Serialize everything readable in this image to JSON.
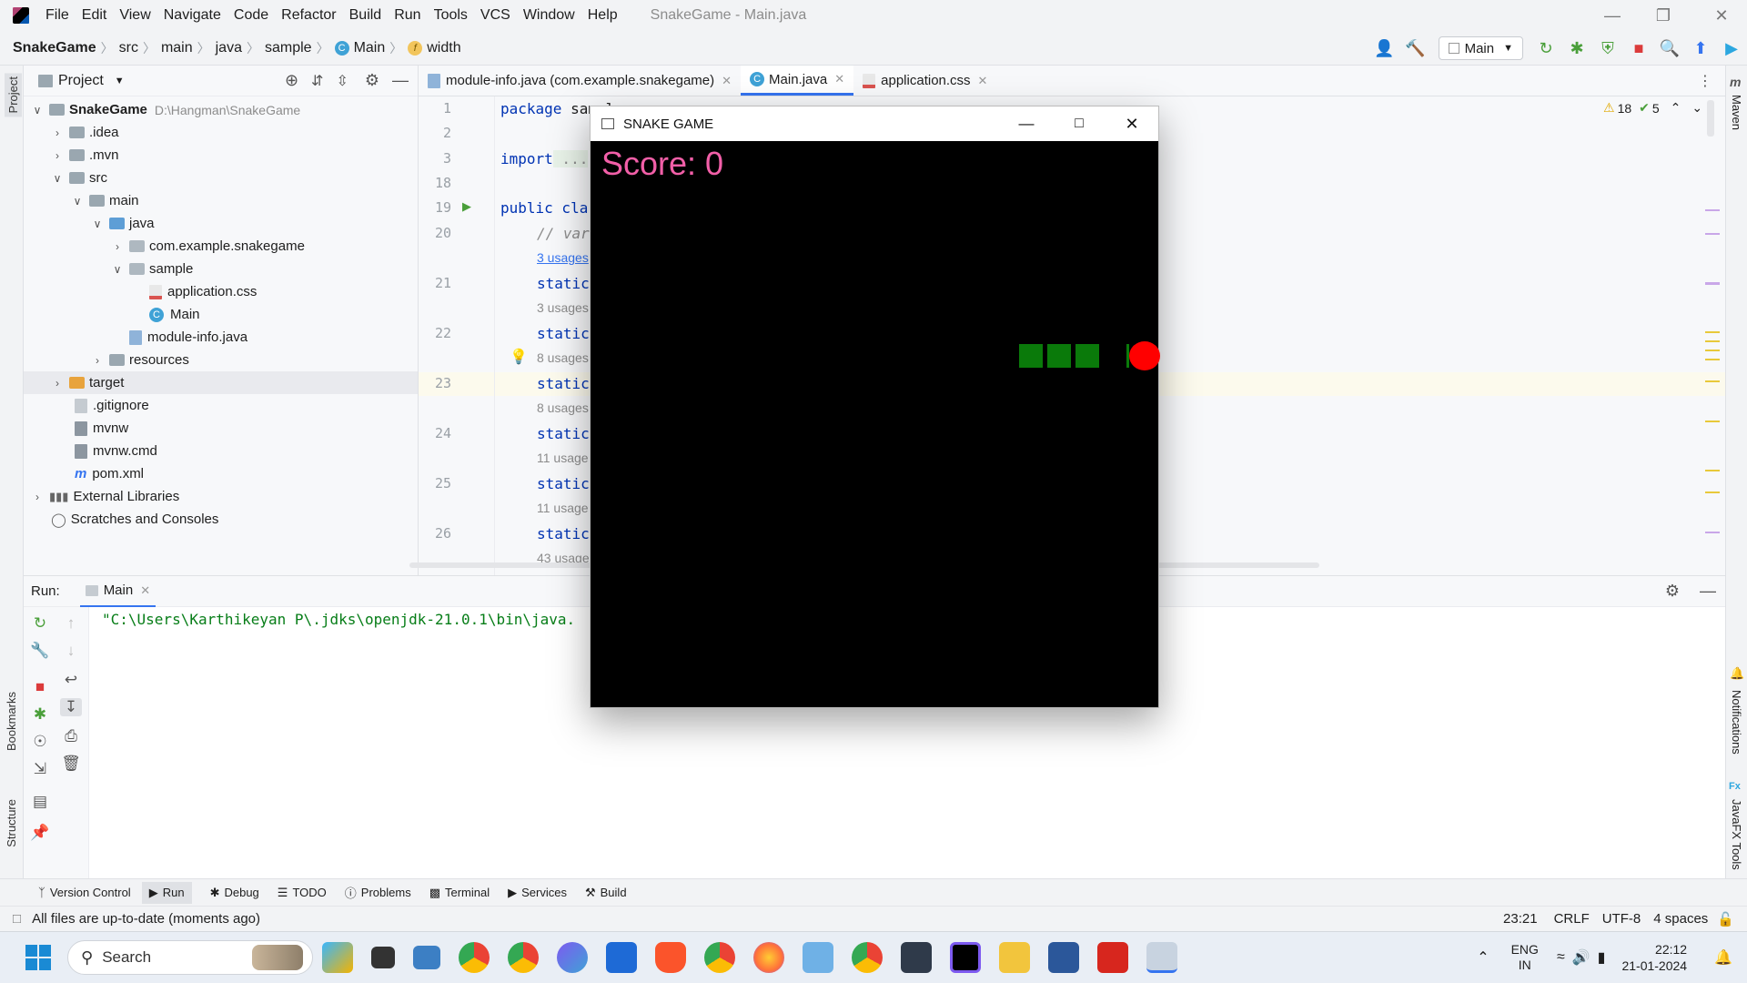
{
  "menubar": {
    "items": [
      "File",
      "Edit",
      "View",
      "Navigate",
      "Code",
      "Refactor",
      "Build",
      "Run",
      "Tools",
      "VCS",
      "Window",
      "Help"
    ],
    "window_title": "SnakeGame - Main.java"
  },
  "navbar": {
    "crumbs": [
      "SnakeGame",
      "src",
      "main",
      "java",
      "sample",
      "Main",
      "width"
    ],
    "run_config": "Main"
  },
  "project": {
    "header": "Project",
    "root_name": "SnakeGame",
    "root_path": "D:\\Hangman\\SnakeGame",
    "items": {
      "idea": ".idea",
      "mvn": ".mvn",
      "src": "src",
      "main": "main",
      "java": "java",
      "pkg1": "com.example.snakegame",
      "sample": "sample",
      "css": "application.css",
      "main_class": "Main",
      "module_info": "module-info.java",
      "resources": "resources",
      "target": "target",
      "gitignore": ".gitignore",
      "mvnw": "mvnw",
      "mvnw_cmd": "mvnw.cmd",
      "pom": "pom.xml",
      "ext_libs": "External Libraries",
      "scratches": "Scratches and Consoles"
    }
  },
  "tabs": [
    "module-info.java (com.example.snakegame)",
    "Main.java",
    "application.css"
  ],
  "editor": {
    "line_numbers": [
      "1",
      "2",
      "3",
      "18",
      "19",
      "20",
      "21",
      "22",
      "23",
      "24",
      "25",
      "26"
    ],
    "code": {
      "l1_kw": "package",
      "l1_rest": " sample;",
      "l3_kw": "import",
      "l3_rest": " ...",
      "l19_kw": "public",
      "l19_rest": " cla",
      "l20": "// var",
      "static": "static"
    },
    "hints": [
      "3 usages",
      "3 usages",
      "8 usages",
      "8 usages",
      "11 usage",
      "11 usage",
      "43 usage"
    ],
    "warnings": "18",
    "checks": "5"
  },
  "run": {
    "label": "Run:",
    "tab": "Main",
    "console": "\"C:\\Users\\Karthikeyan P\\.jdks\\openjdk-21.0.1\\bin\\java."
  },
  "side_labels": {
    "left_top": "Project",
    "bookmarks": "Bookmarks",
    "structure": "Structure",
    "maven": "Maven",
    "notifications": "Notifications",
    "javafx": "JavaFX Tools"
  },
  "tool_tabs": [
    "Version Control",
    "Run",
    "Debug",
    "TODO",
    "Problems",
    "Terminal",
    "Services",
    "Build"
  ],
  "status": {
    "message": "All files are up-to-date (moments ago)",
    "position": "23:21",
    "line_sep": "CRLF",
    "encoding": "UTF-8",
    "indent": "4 spaces"
  },
  "taskbar": {
    "search": "Search",
    "lang1": "ENG",
    "lang2": "IN",
    "time": "22:12",
    "date": "21-01-2024"
  },
  "snake_game": {
    "title": "SNAKE GAME",
    "score_text": "Score: 0",
    "colors": {
      "snake": "#0a7a0a",
      "food": "#ff0000",
      "score": "#f25fa8"
    }
  }
}
